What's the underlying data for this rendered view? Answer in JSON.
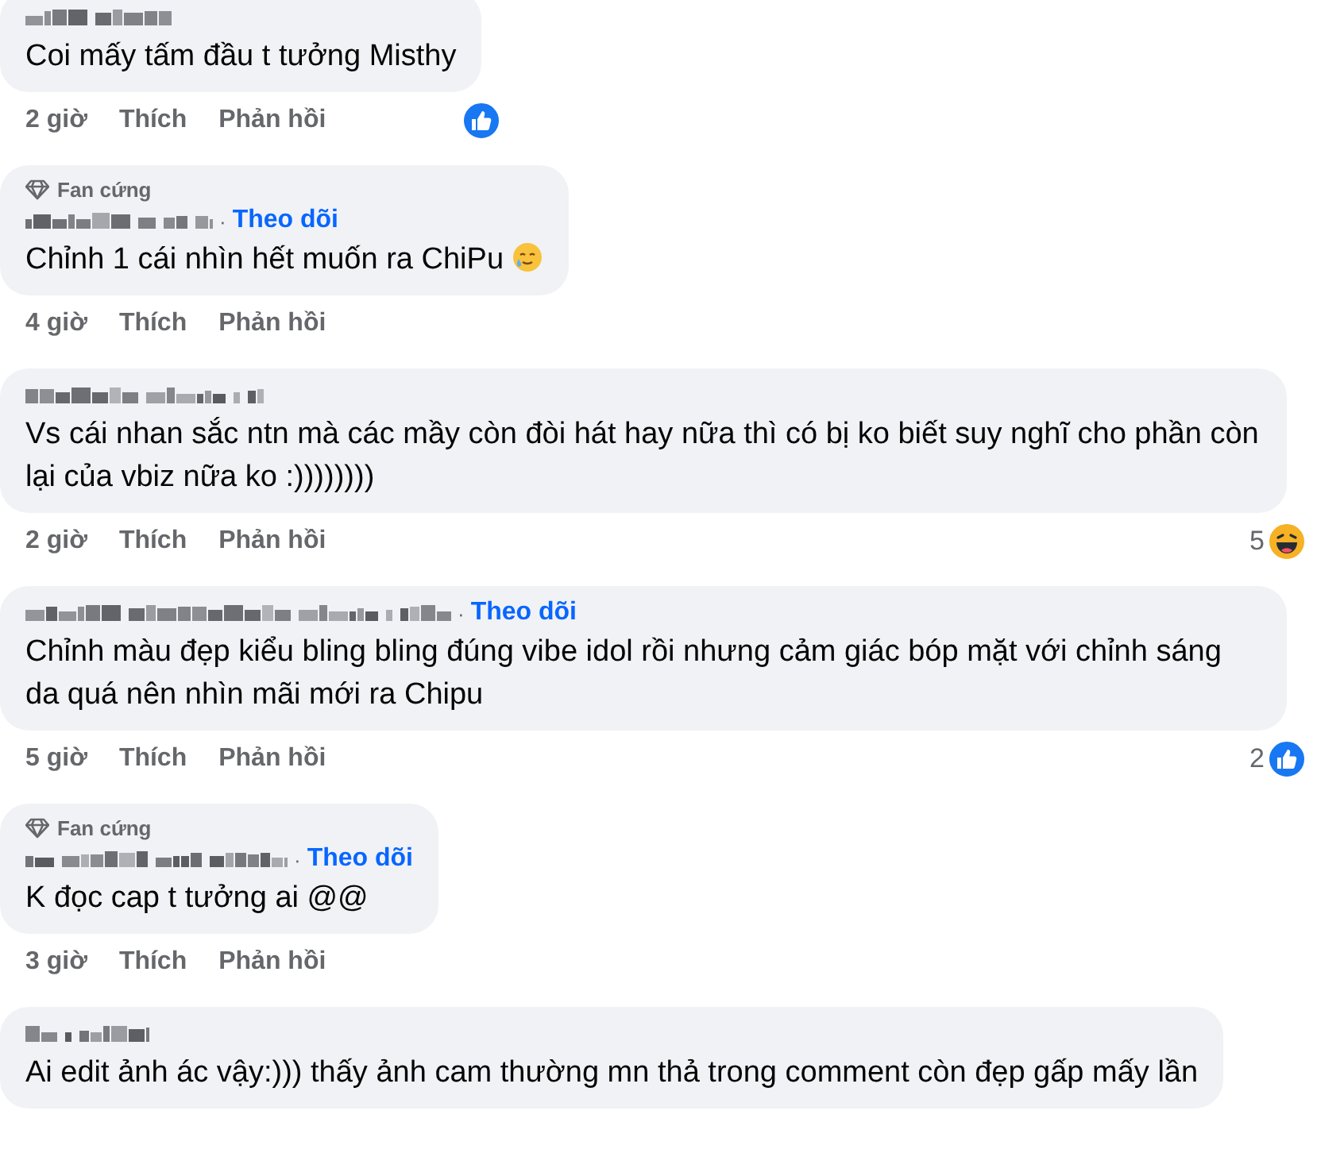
{
  "comments": [
    {
      "author_blurred": true,
      "text": "Coi mấy tấm đầu t tưởng Misthy",
      "time": "2 giờ",
      "like": "Thích",
      "reply": "Phản hồi",
      "reaction": {
        "kind": "like"
      }
    },
    {
      "author_blurred": true,
      "badge": "Fan cứng",
      "separator": "·",
      "follow": "Theo dõi",
      "text": "Chỉnh 1 cái nhìn hết muốn ra ChiPu",
      "end_icon": {
        "kind": "teary-smile"
      },
      "time": "4 giờ",
      "like": "Thích",
      "reply": "Phản hồi"
    },
    {
      "author_blurred": true,
      "text": "Vs cái nhan sắc ntn mà các mầy còn đòi hát hay nữa thì có bị ko biết suy nghĩ cho phần còn lại của vbiz nữa ko :))))))))",
      "time": "2 giờ",
      "like": "Thích",
      "reply": "Phản hồi",
      "reaction": {
        "kind": "haha",
        "count": "5"
      }
    },
    {
      "author_blurred": true,
      "separator": "·",
      "follow": "Theo dõi",
      "text": "Chỉnh màu đẹp kiểu bling bling đúng vibe idol rồi nhưng cảm giác bóp mặt với chỉnh sáng da quá nên nhìn mãi mới ra Chipu",
      "time": "5 giờ",
      "like": "Thích",
      "reply": "Phản hồi",
      "reaction": {
        "kind": "like",
        "count": "2"
      }
    },
    {
      "author_blurred": true,
      "badge": "Fan cứng",
      "separator": "·",
      "follow": "Theo dõi",
      "text": "K đọc cap t tưởng ai @@",
      "time": "3 giờ",
      "like": "Thích",
      "reply": "Phản hồi"
    },
    {
      "author_blurred": true,
      "text": "Ai edit ảnh ác vậy:))) thấy ảnh cam thường mn thả trong comment còn đẹp gấp mấy lần"
    }
  ]
}
